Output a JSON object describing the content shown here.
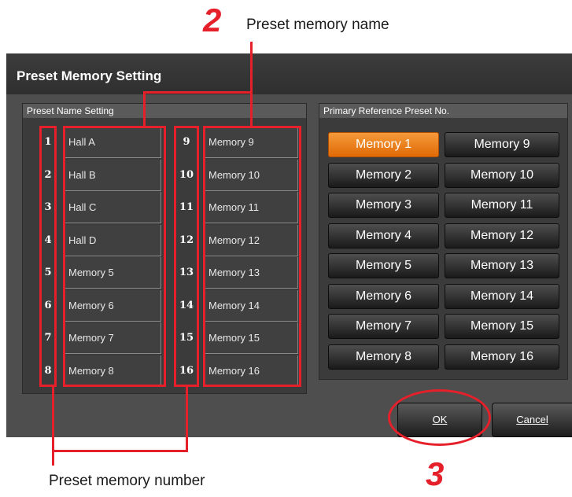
{
  "dialog": {
    "title": "Preset Memory Setting",
    "ok_label": "OK",
    "cancel_label": "Cancel"
  },
  "preset_name_setting": {
    "header": "Preset Name Setting",
    "left": [
      {
        "no": "1",
        "name": "Hall A"
      },
      {
        "no": "2",
        "name": "Hall B"
      },
      {
        "no": "3",
        "name": "Hall C"
      },
      {
        "no": "4",
        "name": "Hall D"
      },
      {
        "no": "5",
        "name": "Memory 5"
      },
      {
        "no": "6",
        "name": "Memory 6"
      },
      {
        "no": "7",
        "name": "Memory 7"
      },
      {
        "no": "8",
        "name": "Memory 8"
      }
    ],
    "right": [
      {
        "no": "9",
        "name": "Memory 9"
      },
      {
        "no": "10",
        "name": "Memory 10"
      },
      {
        "no": "11",
        "name": "Memory 11"
      },
      {
        "no": "12",
        "name": "Memory 12"
      },
      {
        "no": "13",
        "name": "Memory 13"
      },
      {
        "no": "14",
        "name": "Memory 14"
      },
      {
        "no": "15",
        "name": "Memory 15"
      },
      {
        "no": "16",
        "name": "Memory 16"
      }
    ]
  },
  "primary_reference": {
    "header": "Primary Reference Preset No.",
    "selected": "Memory 1",
    "left": [
      "Memory 1",
      "Memory 2",
      "Memory 3",
      "Memory 4",
      "Memory 5",
      "Memory 6",
      "Memory 7",
      "Memory 8"
    ],
    "right": [
      "Memory 9",
      "Memory 10",
      "Memory 11",
      "Memory 12",
      "Memory 13",
      "Memory 14",
      "Memory 15",
      "Memory 16"
    ]
  },
  "annotations": {
    "step_2": "2",
    "step_2_label": "Preset memory name",
    "step_3": "3",
    "step_3_label": "Preset memory number"
  },
  "colors": {
    "accent_orange": "#f08a22",
    "annotation_red": "#e5202a",
    "dialog_bg": "#4e4e4e"
  }
}
